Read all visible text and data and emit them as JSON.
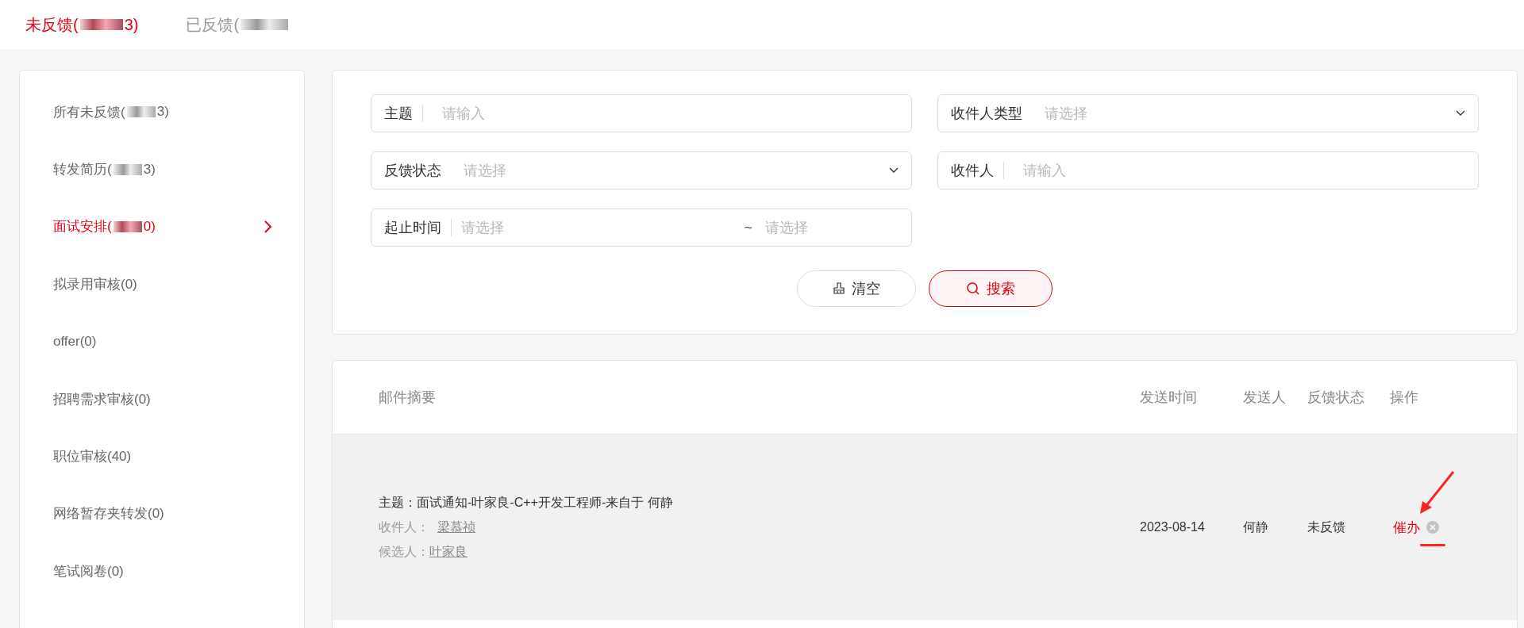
{
  "tabs": [
    {
      "label": "未反馈(",
      "label_end": "3)",
      "selected": true
    },
    {
      "label": "已反馈(",
      "selected": false
    }
  ],
  "sidebar": {
    "items": [
      {
        "label": "所有未反馈(",
        "label_end": "3)",
        "selected": false
      },
      {
        "label": "转发简历(",
        "label_end": "3)",
        "selected": false
      },
      {
        "label": "面试安排(",
        "label_end": "0)",
        "selected": true
      },
      {
        "label": "拟录用审核(0)",
        "selected": false
      },
      {
        "label": "offer(0)",
        "selected": false
      },
      {
        "label": "招聘需求审核(0)",
        "selected": false
      },
      {
        "label": "职位审核(40)",
        "selected": false
      },
      {
        "label": "网络暂存夹转发(0)",
        "selected": false
      },
      {
        "label": "笔试阅卷(0)",
        "selected": false
      }
    ]
  },
  "filters": [
    {
      "kind": "input",
      "label": "主题",
      "placeholder": "请输入"
    },
    {
      "kind": "select",
      "label": "收件人类型",
      "placeholder": "请选择"
    },
    {
      "kind": "select",
      "label": "反馈状态",
      "placeholder": "请选择"
    },
    {
      "kind": "input",
      "label": "收件人",
      "placeholder": "请输入"
    },
    {
      "kind": "range",
      "label": "起止时间",
      "placeholder": "请选择",
      "separator": "~",
      "placeholder_end": "请选择"
    }
  ],
  "buttons": [
    {
      "kind": "clear",
      "label": "清空"
    },
    {
      "kind": "search",
      "label": "搜索"
    }
  ],
  "table": {
    "columns": [
      "邮件摘要",
      "发送时间",
      "发送人",
      "反馈状态",
      "操作"
    ],
    "rows": [
      {
        "selected": true,
        "subject": "主题：面试通知-叶家良-C++开发工程师-来自于 何静",
        "recipient_label": "收件人：",
        "recipient": "梁慕祯",
        "candidate_label": "候选人：",
        "candidate": "叶家良",
        "date": "2023-08-14",
        "sender": "何静",
        "status": "未反馈",
        "action": "催办"
      }
    ]
  }
}
